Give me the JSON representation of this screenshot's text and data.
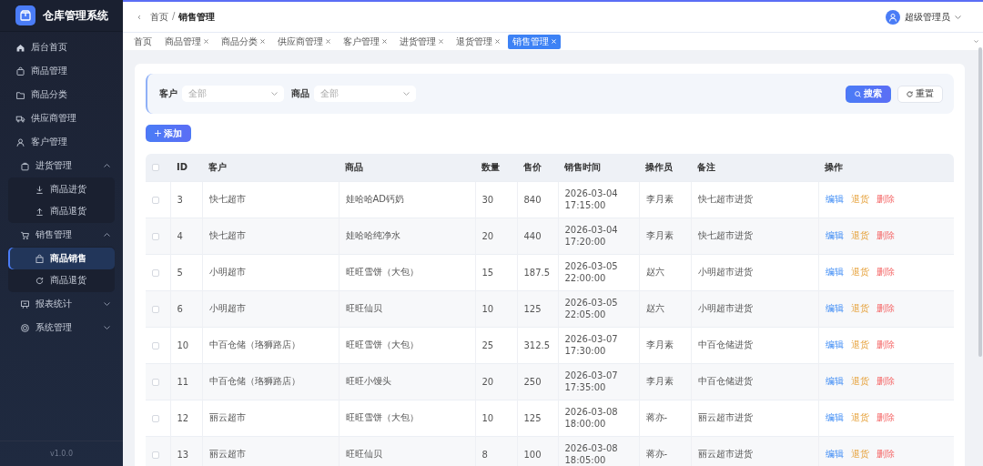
{
  "app": {
    "title": "仓库管理系统",
    "version": "v1.0.0"
  },
  "sidebar": {
    "items": [
      {
        "label": "后台首页",
        "selected": false
      },
      {
        "label": "商品管理",
        "selected": false
      },
      {
        "label": "商品分类",
        "selected": false
      },
      {
        "label": "供应商管理",
        "selected": false
      },
      {
        "label": "客户管理",
        "selected": false
      },
      {
        "label": "进货管理",
        "expanded": true,
        "children": [
          {
            "label": "商品进货",
            "selected": false
          },
          {
            "label": "商品退货",
            "selected": false
          }
        ]
      },
      {
        "label": "销售管理",
        "expanded": true,
        "children": [
          {
            "label": "商品销售",
            "selected": true
          },
          {
            "label": "商品退货",
            "selected": false
          }
        ]
      },
      {
        "label": "报表统计",
        "expanded": false
      },
      {
        "label": "系统管理",
        "expanded": false
      }
    ]
  },
  "header": {
    "breadcrumb": [
      "首页",
      "销售管理"
    ],
    "separator": "/",
    "user": "超级管理员"
  },
  "tabs": [
    {
      "label": "首页",
      "closable": false,
      "selected": false
    },
    {
      "label": "商品管理",
      "closable": true,
      "selected": false
    },
    {
      "label": "商品分类",
      "closable": true,
      "selected": false
    },
    {
      "label": "供应商管理",
      "closable": true,
      "selected": false
    },
    {
      "label": "客户管理",
      "closable": true,
      "selected": false
    },
    {
      "label": "进货管理",
      "closable": true,
      "selected": false
    },
    {
      "label": "退货管理",
      "closable": true,
      "selected": false
    },
    {
      "label": "销售管理",
      "closable": true,
      "selected": true
    }
  ],
  "filters": [
    {
      "label": "客户",
      "placeholder": "全部"
    },
    {
      "label": "商品",
      "placeholder": "全部"
    }
  ],
  "search_button": "搜索",
  "reset_button": "重置",
  "add_button": "添加",
  "table": {
    "header_checked": false,
    "columns": [
      "ID",
      "客户",
      "商品",
      "数量",
      "售价",
      "销售时间",
      "操作员",
      "备注",
      "操作"
    ],
    "rows": [
      {
        "checked": false,
        "cells": [
          "3",
          "快七超市",
          "娃哈哈AD钙奶",
          "30",
          "840",
          "2026-03-04 17:15:00",
          "李月素",
          "快七超市进货"
        ],
        "actions": [
          {
            "label": "编辑",
            "kind": "edit"
          },
          {
            "label": "退货",
            "kind": "return"
          },
          {
            "label": "删除",
            "kind": "delete"
          }
        ]
      },
      {
        "checked": false,
        "cells": [
          "4",
          "快七超市",
          "娃哈哈纯净水",
          "20",
          "440",
          "2026-03-04 17:20:00",
          "李月素",
          "快七超市进货"
        ],
        "actions": [
          {
            "label": "编辑",
            "kind": "edit"
          },
          {
            "label": "退货",
            "kind": "return"
          },
          {
            "label": "删除",
            "kind": "delete"
          }
        ]
      },
      {
        "checked": false,
        "cells": [
          "5",
          "小明超市",
          "旺旺雪饼（大包）",
          "15",
          "187.5",
          "2026-03-05 22:00:00",
          "赵六",
          "小明超市进货"
        ],
        "actions": [
          {
            "label": "编辑",
            "kind": "edit"
          },
          {
            "label": "退货",
            "kind": "return"
          },
          {
            "label": "删除",
            "kind": "delete"
          }
        ]
      },
      {
        "checked": false,
        "cells": [
          "6",
          "小明超市",
          "旺旺仙贝",
          "10",
          "125",
          "2026-03-05 22:05:00",
          "赵六",
          "小明超市进货"
        ],
        "actions": [
          {
            "label": "编辑",
            "kind": "edit"
          },
          {
            "label": "退货",
            "kind": "return"
          },
          {
            "label": "删除",
            "kind": "delete"
          }
        ]
      },
      {
        "checked": false,
        "cells": [
          "10",
          "中百仓储（珞狮路店）",
          "旺旺雪饼（大包）",
          "25",
          "312.5",
          "2026-03-07 17:30:00",
          "李月素",
          "中百仓储进货"
        ],
        "actions": [
          {
            "label": "编辑",
            "kind": "edit"
          },
          {
            "label": "退货",
            "kind": "return"
          },
          {
            "label": "删除",
            "kind": "delete"
          }
        ]
      },
      {
        "checked": false,
        "cells": [
          "11",
          "中百仓储（珞狮路店）",
          "旺旺小馒头",
          "20",
          "250",
          "2026-03-07 17:35:00",
          "李月素",
          "中百仓储进货"
        ],
        "actions": [
          {
            "label": "编辑",
            "kind": "edit"
          },
          {
            "label": "退货",
            "kind": "return"
          },
          {
            "label": "删除",
            "kind": "delete"
          }
        ]
      },
      {
        "checked": false,
        "cells": [
          "12",
          "丽云超市",
          "旺旺雪饼（大包）",
          "10",
          "125",
          "2026-03-08 18:00:00",
          "蒋亦-",
          "丽云超市进货"
        ],
        "actions": [
          {
            "label": "编辑",
            "kind": "edit"
          },
          {
            "label": "退货",
            "kind": "return"
          },
          {
            "label": "删除",
            "kind": "delete"
          }
        ]
      },
      {
        "checked": false,
        "cells": [
          "13",
          "丽云超市",
          "旺旺仙贝",
          "8",
          "100",
          "2026-03-08 18:05:00",
          "蒋亦-",
          "丽云超市进货"
        ],
        "actions": [
          {
            "label": "编辑",
            "kind": "edit"
          },
          {
            "label": "退货",
            "kind": "return"
          },
          {
            "label": "删除",
            "kind": "delete"
          }
        ]
      }
    ]
  }
}
